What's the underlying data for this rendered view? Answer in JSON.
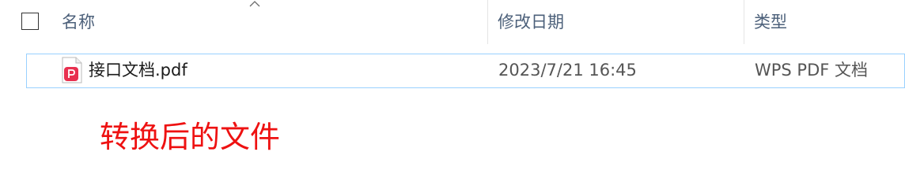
{
  "header": {
    "columns": {
      "name": "名称",
      "modified": "修改日期",
      "type": "类型"
    },
    "sort_indicator": "up-caret-icon"
  },
  "files": [
    {
      "name": "接口文档.pdf",
      "modified": "2023/7/21 16:45",
      "type": "WPS PDF 文档",
      "icon": "wps-pdf-file-icon"
    }
  ],
  "annotation": {
    "text": "转换后的文件",
    "color": "#ee1111"
  },
  "colors": {
    "row_highlight_border": "#99d1ff",
    "header_text": "#4c607a",
    "pdf_icon_red": "#e8304f"
  }
}
